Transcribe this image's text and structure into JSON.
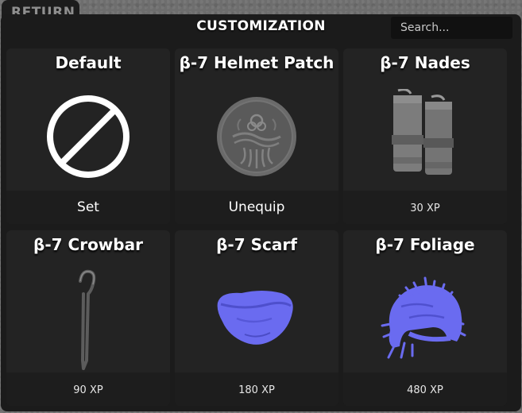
{
  "header": {
    "return_label": "RETURN",
    "title": "CUSTOMIZATION",
    "search_placeholder": "Search..."
  },
  "items": [
    {
      "name": "Default",
      "footer": "Set",
      "icon": "none-prohibited-icon"
    },
    {
      "name": "β-7 Helmet Patch",
      "footer": "Unequip",
      "icon": "biohazard-patch-icon"
    },
    {
      "name": "β-7 Nades",
      "footer": "30 XP",
      "icon": "grenades-icon"
    },
    {
      "name": "β-7 Crowbar",
      "footer": "90 XP",
      "icon": "crowbar-icon"
    },
    {
      "name": "β-7 Scarf",
      "footer": "180 XP",
      "icon": "scarf-icon"
    },
    {
      "name": "β-7 Foliage",
      "footer": "480 XP",
      "icon": "foliage-helmet-icon"
    }
  ],
  "colors": {
    "panel": "#1b1b1b",
    "card": "#232323",
    "item_preview_blue": "#6a6bf0"
  }
}
